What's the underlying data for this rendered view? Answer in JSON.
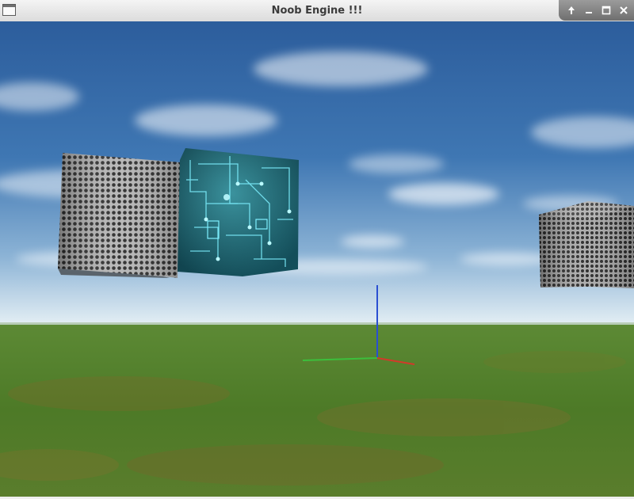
{
  "window": {
    "title": "Noob Engine !!!"
  },
  "titlebar_controls": [
    {
      "name": "keep-above-icon",
      "label": "up-arrow"
    },
    {
      "name": "minimize-icon",
      "label": "minimize"
    },
    {
      "name": "maximize-icon",
      "label": "maximize"
    },
    {
      "name": "close-icon",
      "label": "close"
    }
  ],
  "scene": {
    "sky_color_top": "#2e5f9e",
    "sky_color_horizon": "#c7dbe8",
    "ground_color": "#4f7d2a",
    "cube_textures": [
      "metal-grid",
      "circuit-board",
      "metal-grid"
    ],
    "axis_colors": {
      "x": "#d23a2a",
      "y": "#2a4fd2",
      "z": "#3cbf3c"
    }
  }
}
